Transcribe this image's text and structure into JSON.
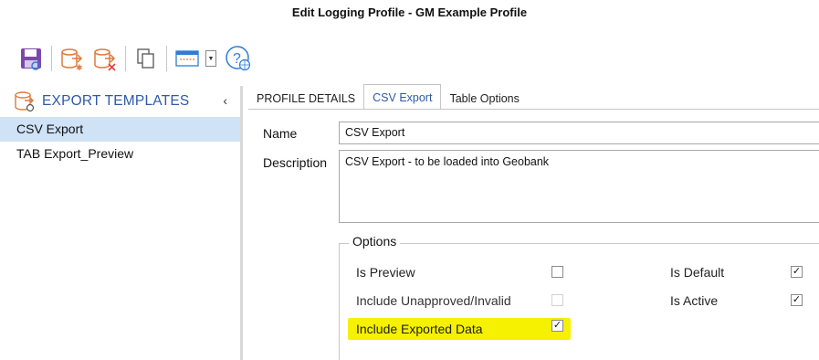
{
  "window": {
    "title": "Edit Logging Profile - GM Example Profile"
  },
  "toolbar": {
    "buttons": [
      {
        "icon": "save-icon"
      },
      {
        "icon": "export-template-add-icon"
      },
      {
        "icon": "export-template-delete-icon"
      },
      {
        "icon": "copy-icon"
      },
      {
        "icon": "window-layout-icon"
      },
      {
        "icon": "dropdown-arrow-icon"
      },
      {
        "icon": "help-globe-icon"
      }
    ]
  },
  "sidebar": {
    "title": "EXPORT TEMPLATES",
    "collapse_glyph": "‹",
    "items": [
      {
        "label": "CSV Export",
        "selected": true
      },
      {
        "label": "TAB Export_Preview",
        "selected": false
      }
    ]
  },
  "tabs": [
    {
      "label": "PROFILE DETAILS",
      "active": false
    },
    {
      "label": "CSV Export",
      "active": true
    },
    {
      "label": "Table Options",
      "active": false
    }
  ],
  "form": {
    "name_label": "Name",
    "name_value": "CSV Export",
    "description_label": "Description",
    "description_value": "CSV Export - to be loaded into Geobank"
  },
  "options": {
    "title": "Options",
    "is_preview": {
      "label": "Is Preview",
      "checked": false,
      "enabled": true
    },
    "include_unapproved": {
      "label": "Include Unapproved/Invalid",
      "checked": false,
      "enabled": false
    },
    "include_exported": {
      "label": "Include Exported Data",
      "checked": true,
      "enabled": true,
      "highlighted": true
    },
    "is_default": {
      "label": "Is Default",
      "checked": true,
      "enabled": true
    },
    "is_active": {
      "label": "Is Active",
      "checked": true,
      "enabled": true
    }
  },
  "colors": {
    "accent": "#2d5aa8",
    "selection": "#cfe2f6",
    "highlight": "#f5f100"
  }
}
